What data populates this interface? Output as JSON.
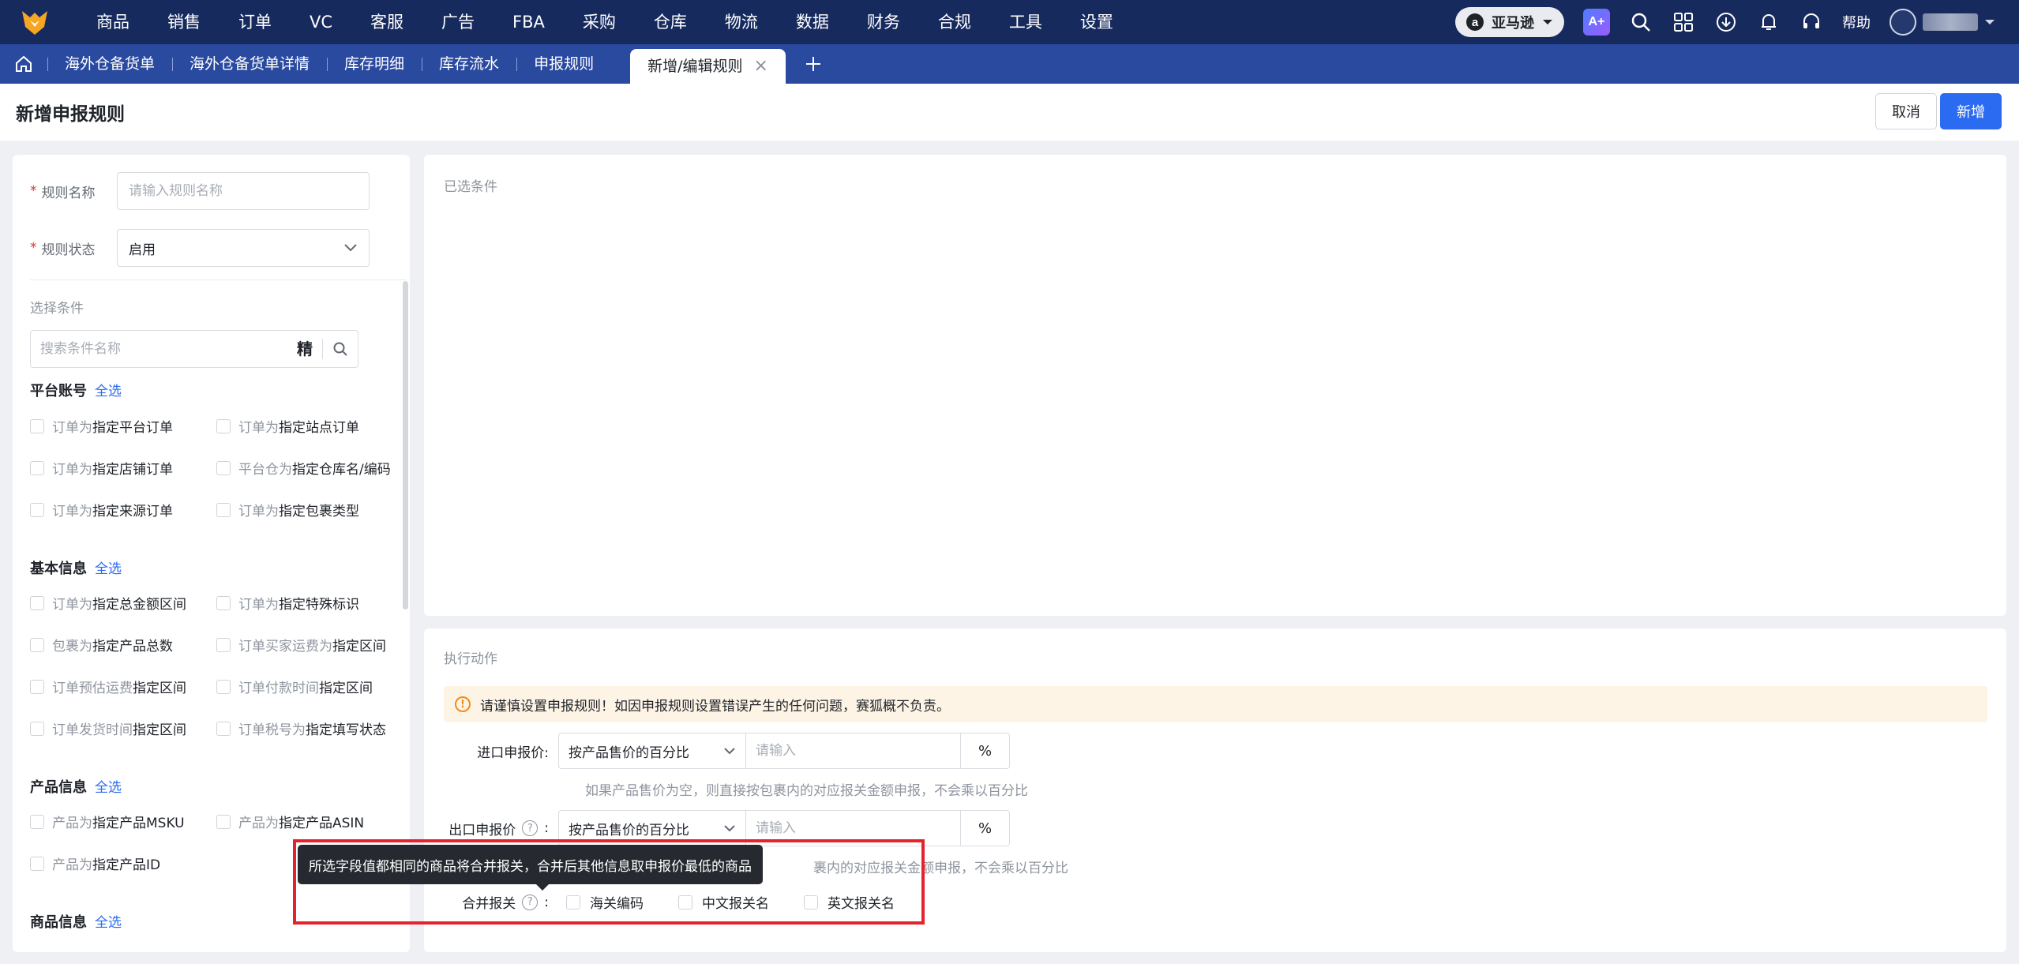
{
  "nav": {
    "menu": [
      "商品",
      "销售",
      "订单",
      "VC",
      "客服",
      "广告",
      "FBA",
      "采购",
      "仓库",
      "物流",
      "数据",
      "财务",
      "合规",
      "工具",
      "设置"
    ],
    "marketplace": "亚马逊",
    "help": "帮助"
  },
  "tabs": {
    "items": [
      "海外仓备货单",
      "海外仓备货单详情",
      "库存明细",
      "库存流水",
      "申报规则"
    ],
    "active": "新增/编辑规则",
    "close": "×"
  },
  "page": {
    "title": "新增申报规则",
    "cancel": "取消",
    "submit": "新增"
  },
  "form": {
    "rule_name_label": "规则名称",
    "rule_name_placeholder": "请输入规则名称",
    "rule_status_label": "规则状态",
    "rule_status_value": "启用",
    "required_mark": "*"
  },
  "conditions": {
    "section_label": "选择条件",
    "search_placeholder": "搜索条件名称",
    "precise": "精",
    "select_all": "全选",
    "groups": [
      {
        "title": "平台账号",
        "items": [
          {
            "pre": "订单为",
            "post": "指定平台订单"
          },
          {
            "pre": "订单为",
            "post": "指定站点订单"
          },
          {
            "pre": "订单为",
            "post": "指定店铺订单"
          },
          {
            "pre": "平台仓为",
            "post": "指定仓库名/编码"
          },
          {
            "pre": "订单为",
            "post": "指定来源订单"
          },
          {
            "pre": "订单为",
            "post": "指定包裹类型"
          }
        ]
      },
      {
        "title": "基本信息",
        "items": [
          {
            "pre": "订单为",
            "post": "指定总金额区间"
          },
          {
            "pre": "订单为",
            "post": "指定特殊标识"
          },
          {
            "pre": "包裹为",
            "post": "指定产品总数"
          },
          {
            "pre": "订单买家运费为",
            "post": "指定区间"
          },
          {
            "pre": "订单预估运费",
            "post": "指定区间"
          },
          {
            "pre": "订单付款时间",
            "post": "指定区间"
          },
          {
            "pre": "订单发货时间",
            "post": "指定区间"
          },
          {
            "pre": "订单税号为",
            "post": "指定填写状态"
          }
        ]
      },
      {
        "title": "产品信息",
        "items": [
          {
            "pre": "产品为",
            "post": "指定产品MSKU"
          },
          {
            "pre": "产品为",
            "post": "指定产品ASIN"
          },
          {
            "pre": "产品为",
            "post": "指定产品ID"
          }
        ]
      },
      {
        "title": "商品信息",
        "items": []
      }
    ]
  },
  "selected": {
    "label": "已选条件"
  },
  "actions": {
    "label": "执行动作",
    "alert": "请谨慎设置申报规则！如因申报规则设置错误产生的任何问题，赛狐概不负责。",
    "import_label": "进口申报价:",
    "export_label": "出口申报价",
    "method_value": "按产品售价的百分比",
    "input_placeholder": "请输入",
    "percent": "%",
    "hint": "如果产品售价为空，则直接按包裹内的对应报关金额申报，不会乘以百分比",
    "hint_partial": "裹内的对应报关金额申报，不会乘以百分比",
    "merge_label": "合并报关",
    "merge_options": [
      "海关编码",
      "中文报关名",
      "英文报关名"
    ],
    "colon": ":"
  },
  "tooltip": {
    "text": "所选字段值都相同的商品将合并报关，合并后其他信息取申报价最低的商品"
  },
  "colors": {
    "nav_bg": "#172a5e",
    "tab_bg": "#2a4aa0",
    "primary": "#2a6bf2",
    "highlight": "#e5232c"
  }
}
